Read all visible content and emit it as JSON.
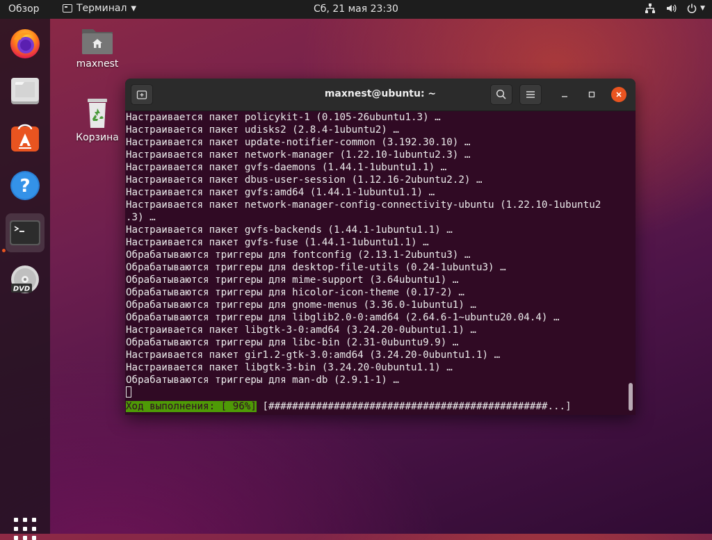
{
  "topbar": {
    "overview": "Обзор",
    "app_menu": "Терминал",
    "clock": "Сб, 21 мая  23:30"
  },
  "dock": {
    "items": [
      "firefox-icon",
      "files-icon",
      "software-icon",
      "help-icon",
      "terminal-icon",
      "dvd-icon"
    ],
    "active": "terminal-icon",
    "accent": "#e95420"
  },
  "desktop": {
    "icons": [
      {
        "label": "maxnest",
        "icon": "home-folder-icon"
      },
      {
        "label": "Корзина",
        "icon": "trash-icon"
      }
    ]
  },
  "window": {
    "title": "maxnest@ubuntu: ~",
    "terminal_bg": "#300a24"
  },
  "terminal": {
    "lines": [
      "Настраивается пакет policykit-1 (0.105-26ubuntu1.3) …",
      "Настраивается пакет udisks2 (2.8.4-1ubuntu2) …",
      "Настраивается пакет update-notifier-common (3.192.30.10) …",
      "Настраивается пакет network-manager (1.22.10-1ubuntu2.3) …",
      "Настраивается пакет gvfs-daemons (1.44.1-1ubuntu1.1) …",
      "Настраивается пакет dbus-user-session (1.12.16-2ubuntu2.2) …",
      "Настраивается пакет gvfs:amd64 (1.44.1-1ubuntu1.1) …",
      "Настраивается пакет network-manager-config-connectivity-ubuntu (1.22.10-1ubuntu2",
      ".3) …",
      "Настраивается пакет gvfs-backends (1.44.1-1ubuntu1.1) …",
      "Настраивается пакет gvfs-fuse (1.44.1-1ubuntu1.1) …",
      "Обрабатываются триггеры для fontconfig (2.13.1-2ubuntu3) …",
      "Обрабатываются триггеры для desktop-file-utils (0.24-1ubuntu3) …",
      "Обрабатываются триггеры для mime-support (3.64ubuntu1) …",
      "Обрабатываются триггеры для hicolor-icon-theme (0.17-2) …",
      "Обрабатываются триггеры для gnome-menus (3.36.0-1ubuntu1) …",
      "Обрабатываются триггеры для libglib2.0-0:amd64 (2.64.6-1~ubuntu20.04.4) …",
      "Настраивается пакет libgtk-3-0:amd64 (3.24.20-0ubuntu1.1) …",
      "Обрабатываются триггеры для libc-bin (2.31-0ubuntu9.9) …",
      "Настраивается пакет gir1.2-gtk-3.0:amd64 (3.24.20-0ubuntu1.1) …",
      "Настраивается пакет libgtk-3-bin (3.24.20-0ubuntu1.1) …",
      "Обрабатываются триггеры для man-db (2.9.1-1) …"
    ],
    "progress_label": "Ход выполнения: [ 96%]",
    "progress_bar": " [###############################################...]",
    "progress_percent": 96,
    "progress_color": "#4e9a06"
  }
}
